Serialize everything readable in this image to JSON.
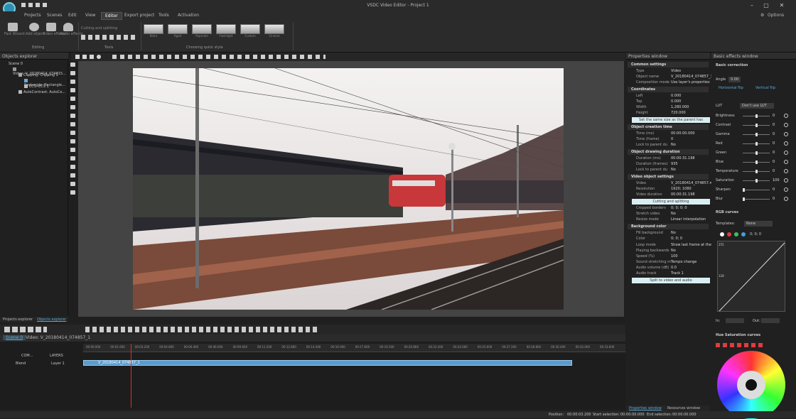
{
  "window": {
    "title": "VSDC Video Editor - Project 1",
    "options_label": "Options"
  },
  "menu": [
    "Projects",
    "Scenes",
    "Edit",
    "View",
    "Editor",
    "Export project",
    "Tools",
    "Activation"
  ],
  "ribbon": {
    "editing_buttons": [
      "Fast Wizard",
      "Add object",
      "Video effects",
      "Audio effects"
    ],
    "editing_group": "Editing",
    "tools_cutting": "Cutting and splitting",
    "tools_group": "Tools",
    "quick_styles": [
      "Retro",
      "Aged",
      "Popscale",
      "Flashlight",
      "Custom",
      "Cinema"
    ],
    "quick_style_group": "Choosing quick style"
  },
  "objects_explorer": {
    "title": "Objects explorer",
    "tree": [
      "Scene 0",
      "Video: V_20180414_074815...",
      "Clipping: Clipping 1",
      "Rectangle: Rectangle...",
      "ECS: ECS 1",
      "AutoContrast: AutoCo..."
    ],
    "tabs": [
      "Projects explorer",
      "Objects explorer"
    ]
  },
  "properties": {
    "title": "Properties window",
    "common_section": "Common settings",
    "rows1": [
      {
        "k": "Type",
        "v": "Video"
      },
      {
        "k": "Object name",
        "v": "V_20180414_074857_1"
      },
      {
        "k": "Composition mode",
        "v": "Use layer's properties"
      }
    ],
    "coord_section": "Coordinates",
    "coords": [
      {
        "k": "Left",
        "v": "0.000"
      },
      {
        "k": "Top",
        "v": "0.000"
      },
      {
        "k": "Width",
        "v": "1,280.000"
      },
      {
        "k": "Height",
        "v": "720.000"
      }
    ],
    "same_size_btn": "Set the same size as the parent has",
    "creation_section": "Object creation time",
    "creation": [
      {
        "k": "Time (ms)",
        "v": "00:00:00.000"
      },
      {
        "k": "Time (frame)",
        "v": "0"
      },
      {
        "k": "Lock to parent du",
        "v": "No"
      }
    ],
    "duration_section": "Object drawing duration",
    "duration": [
      {
        "k": "Duration (ms)",
        "v": "00:00:31.198"
      },
      {
        "k": "Duration (frames)",
        "v": "935"
      },
      {
        "k": "Lock to parent du",
        "v": "No"
      }
    ],
    "video_section": "Video object settings",
    "video": [
      {
        "k": "Video",
        "v": "V_20180414_074857.m"
      },
      {
        "k": "Resolution",
        "v": "1920; 1080"
      },
      {
        "k": "Video duration",
        "v": "00:00:31.198"
      }
    ],
    "cut_btn": "Cutting and splitting",
    "video2": [
      {
        "k": "Cropped borders",
        "v": "0; 0; 0; 0"
      },
      {
        "k": "Stretch video",
        "v": "No"
      },
      {
        "k": "Resize mode",
        "v": "Linear interpolation"
      }
    ],
    "bg_section": "Background color",
    "bg": [
      {
        "k": "Fill background",
        "v": "No"
      },
      {
        "k": "Color",
        "v": "0; 0; 0"
      }
    ],
    "misc": [
      {
        "k": "Loop mode",
        "v": "Show last frame at the"
      },
      {
        "k": "Playing backwards",
        "v": "No"
      },
      {
        "k": "Speed (%)",
        "v": "100"
      },
      {
        "k": "Sound stretching m",
        "v": "Tempo change"
      },
      {
        "k": "Audio volume (dB)",
        "v": "0.0"
      },
      {
        "k": "Audio track",
        "v": "Track 1"
      }
    ],
    "split_btn": "Split to video and audio",
    "tabs": [
      "Properties window",
      "Resources window"
    ]
  },
  "effects": {
    "title": "Basic effects window",
    "basic_section": "Basic correction",
    "angle_label": "Angle",
    "angle_value": "0.00",
    "flip_h": "Horizontal flip",
    "flip_v": "Vertical flip",
    "lut_label": "LUT",
    "lut_value": "Don't use LUT",
    "adjustments": [
      {
        "k": "Brightness",
        "v": "0",
        "pos": 0.5
      },
      {
        "k": "Contrast",
        "v": "0",
        "pos": 0.5
      },
      {
        "k": "Gamma",
        "v": "0",
        "pos": 0.5
      },
      {
        "k": "Red",
        "v": "0",
        "pos": 0.5
      },
      {
        "k": "Green",
        "v": "0",
        "pos": 0.5
      },
      {
        "k": "Blue",
        "v": "0",
        "pos": 0.5
      },
      {
        "k": "Temperature",
        "v": "0",
        "pos": 0.5
      },
      {
        "k": "Saturation",
        "v": "100",
        "pos": 0.5
      },
      {
        "k": "Sharpen",
        "v": "0",
        "pos": 0.0
      },
      {
        "k": "Blur",
        "v": "0",
        "pos": 0.0
      }
    ],
    "rgb_section": "RGB curves",
    "templates_label": "Templates:",
    "templates_value": "None",
    "curve_readout": "0; 0; 0",
    "curve_top": "255",
    "curve_mid": "128",
    "in_label": "In:",
    "out_label": "Out:",
    "hue_section": "Hue Saturation curves"
  },
  "timeline": {
    "tabs": [
      "Scene 0",
      "Video: V_20180414_074857_1"
    ],
    "track_headers": [
      "COM...",
      "LAYERS"
    ],
    "blend": "Blend",
    "layer": "Layer 1",
    "clip_label": "V_20180414_074857_1",
    "ruler_ticks": [
      "00:00.000",
      "00:01.600",
      "00:03.200",
      "00:04.800",
      "00:06.400",
      "00:08.000",
      "00:09.600",
      "00:11.200",
      "00:12.800",
      "00:14.400",
      "00:16.000",
      "00:17.600",
      "00:19.200",
      "00:20.800",
      "00:22.400",
      "00:24.000",
      "00:25.600",
      "00:27.200",
      "00:28.800",
      "00:30.400",
      "00:32.000",
      "00:33.600"
    ]
  },
  "status": {
    "position_label": "Position:",
    "position": "00:00:03.200",
    "start_label": "Start selection:",
    "start": "00:00:00.000",
    "end_label": "End selection:",
    "end": "00:00:00.000"
  },
  "colors": {
    "accent": "#5fa7d3",
    "clip": "#5b9ccf",
    "playhead": "#d83030"
  }
}
